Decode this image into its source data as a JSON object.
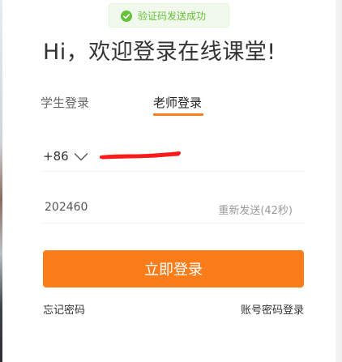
{
  "toast": {
    "message": "验证码发送成功",
    "icon": "check-circle-icon",
    "color": "#67c23a"
  },
  "title": "Hi，欢迎登录在线课堂!",
  "tabs": [
    {
      "label": "学生登录",
      "active": false
    },
    {
      "label": "老师登录",
      "active": true
    }
  ],
  "phone": {
    "country_code": "+86",
    "dropdown_icon": "chevron-down-icon",
    "number_redacted": true
  },
  "code": {
    "value": "202460",
    "resend_label": "重新发送(42秒)"
  },
  "login_button": "立即登录",
  "links": {
    "forgot_password": "忘记密码",
    "account_password_login": "账号密码登录"
  },
  "colors": {
    "accent": "#fa7d1a",
    "success": "#67c23a",
    "redaction": "#ff0000"
  }
}
